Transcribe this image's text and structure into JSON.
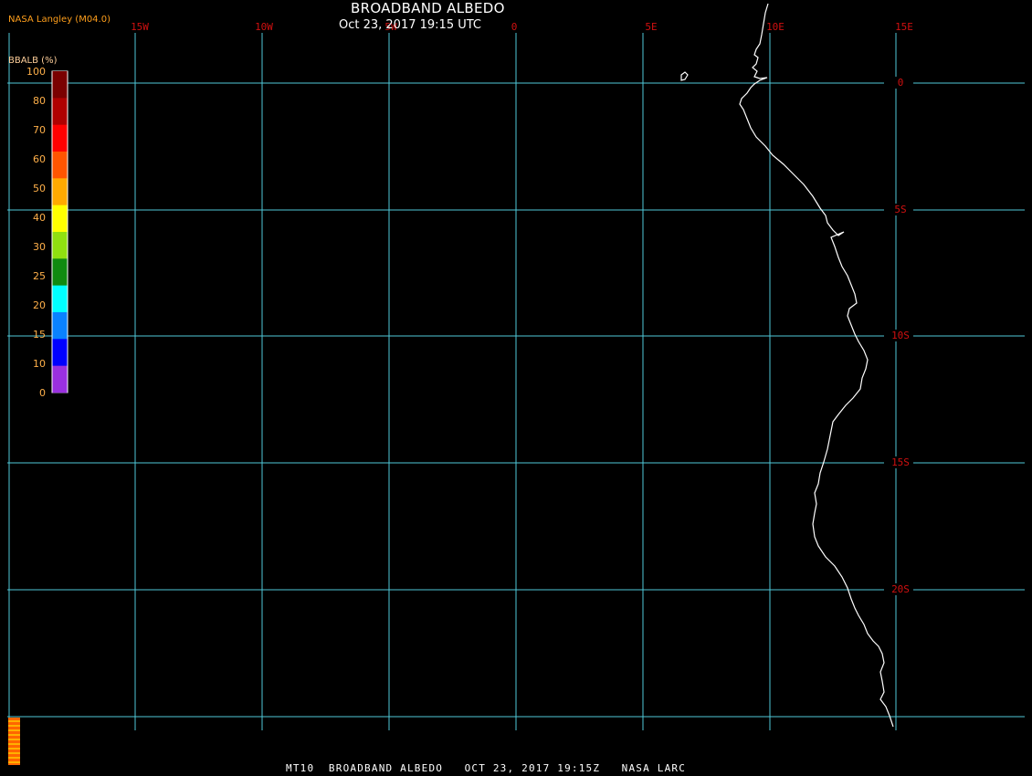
{
  "header": {
    "title": "BROADBAND ALBEDO",
    "datetime": "Oct 23, 2017 19:15 UTC",
    "credit": "NASA Langley (M04.0)"
  },
  "legend": {
    "title": "BBALB (%)",
    "ticks": [
      "100",
      "80",
      "70",
      "60",
      "50",
      "40",
      "30",
      "25",
      "20",
      "15",
      "10",
      "0"
    ],
    "colors": [
      "#7a0000",
      "#b00000",
      "#ff0000",
      "#ff5500",
      "#ffaa00",
      "#ffff00",
      "#90e010",
      "#108a10",
      "#00ffff",
      "#0a82ff",
      "#0000ff",
      "#9a30e0"
    ]
  },
  "map": {
    "grid_color": "#4fc8d8",
    "coast_color": "#ffffff",
    "label_color": "#d01010",
    "lon_labels": [
      "15W",
      "10W",
      "5W",
      "0",
      "5E",
      "10E",
      "15E"
    ],
    "lat_labels": [
      "0",
      "5S",
      "10S",
      "15S",
      "20S"
    ]
  },
  "footer": {
    "text": "MT10  BROADBAND ALBEDO   OCT 23, 2017 19:15Z   NASA LARC"
  }
}
